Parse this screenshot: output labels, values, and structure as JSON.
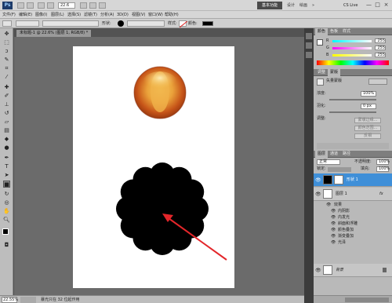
{
  "app": {
    "logo": "Ps",
    "zoom_top": "22.6"
  },
  "workspace": {
    "active_label": "基本功能",
    "tabs": [
      "设计",
      "绘画"
    ],
    "cs_live": "CS Live",
    "window_controls": [
      "—",
      "□",
      "×"
    ]
  },
  "menu": [
    "文件(F)",
    "编辑(E)",
    "图像(I)",
    "图层(L)",
    "选择(S)",
    "滤镜(T)",
    "分析(A)",
    "3D(D)",
    "视图(V)",
    "窗口(W)",
    "帮助(H)"
  ],
  "options": {
    "shape_label": "形状:",
    "style_label": "样式:",
    "color_label": "颜色:",
    "color": "#000000"
  },
  "document": {
    "tab_label": "未标题-1 @ 22.6% (图层 1, RGB/8) *"
  },
  "status": {
    "zoom": "22.55%",
    "info": "暴光只在 32 位起作用"
  },
  "colors": {
    "orb_outer": "#d0621c",
    "orb_inner": "#f2b63a",
    "arrow": "#e3262a",
    "flower": "#000000",
    "selected_layer": "#3f8fd8"
  },
  "color_panel": {
    "tabs": [
      "颜色",
      "色板",
      "样式"
    ],
    "sliders": [
      {
        "label": "R",
        "value": "255"
      },
      {
        "label": "G",
        "value": "255"
      },
      {
        "label": "B",
        "value": "255"
      }
    ]
  },
  "mask_panel": {
    "tabs": [
      "调整",
      "蒙版"
    ],
    "title": "矢量蒙版",
    "density_label": "浓度:",
    "density_value": "100%",
    "feather_label": "羽化:",
    "feather_value": "0 px",
    "refine_label": "调整:",
    "buttons": [
      "蒙版边缘...",
      "颜色范围...",
      "反相"
    ]
  },
  "layers_panel": {
    "tabs": [
      "图层",
      "通道",
      "路径"
    ],
    "blend_mode": "正常",
    "opacity_label": "不透明度:",
    "opacity_value": "100%",
    "lock_label": "锁定:",
    "fill_label": "填充:",
    "fill_value": "100%",
    "layers": [
      {
        "name": "形状 1",
        "selected": true
      },
      {
        "name": "图层 1",
        "selected": false,
        "fx": "fx"
      },
      {
        "name": "背景",
        "selected": false
      }
    ],
    "effects_header": "效果",
    "effects": [
      "内阴影",
      "内发光",
      "斜面和浮雕",
      "颜色叠加",
      "渐变叠加",
      "光泽"
    ]
  }
}
